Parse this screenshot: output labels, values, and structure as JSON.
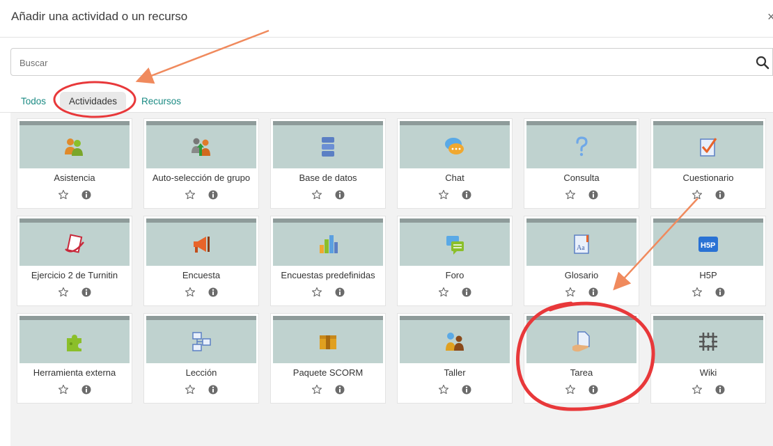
{
  "dialog": {
    "title": "Añadir una actividad o un recurso",
    "close_label": "×"
  },
  "search": {
    "placeholder": "Buscar",
    "value": ""
  },
  "tabs": [
    {
      "label": "Todos",
      "active": false
    },
    {
      "label": "Actividades",
      "active": true
    },
    {
      "label": "Recursos",
      "active": false
    }
  ],
  "activities": [
    {
      "label": "Asistencia",
      "icon": "attendance-icon"
    },
    {
      "label": "Auto-selección de grupo",
      "icon": "group-selection-icon"
    },
    {
      "label": "Base de datos",
      "icon": "database-icon"
    },
    {
      "label": "Chat",
      "icon": "chat-icon"
    },
    {
      "label": "Consulta",
      "icon": "choice-icon"
    },
    {
      "label": "Cuestionario",
      "icon": "quiz-icon"
    },
    {
      "label": "Ejercicio 2 de Turnitin",
      "icon": "turnitin-icon"
    },
    {
      "label": "Encuesta",
      "icon": "megaphone-icon"
    },
    {
      "label": "Encuestas predefinidas",
      "icon": "bar-chart-icon"
    },
    {
      "label": "Foro",
      "icon": "forum-icon"
    },
    {
      "label": "Glosario",
      "icon": "glossary-icon"
    },
    {
      "label": "H5P",
      "icon": "h5p-icon"
    },
    {
      "label": "Herramienta externa",
      "icon": "puzzle-icon"
    },
    {
      "label": "Lección",
      "icon": "lesson-icon"
    },
    {
      "label": "Paquete SCORM",
      "icon": "package-icon"
    },
    {
      "label": "Taller",
      "icon": "workshop-icon"
    },
    {
      "label": "Tarea",
      "icon": "assignment-icon"
    },
    {
      "label": "Wiki",
      "icon": "wiki-icon"
    }
  ],
  "colors": {
    "link": "#1a8a83",
    "card_header": "#bfd2cf",
    "card_header_bar": "#8e9b9a",
    "annotation_arrow": "#f08a5d",
    "annotation_circle": "#e8383a"
  }
}
